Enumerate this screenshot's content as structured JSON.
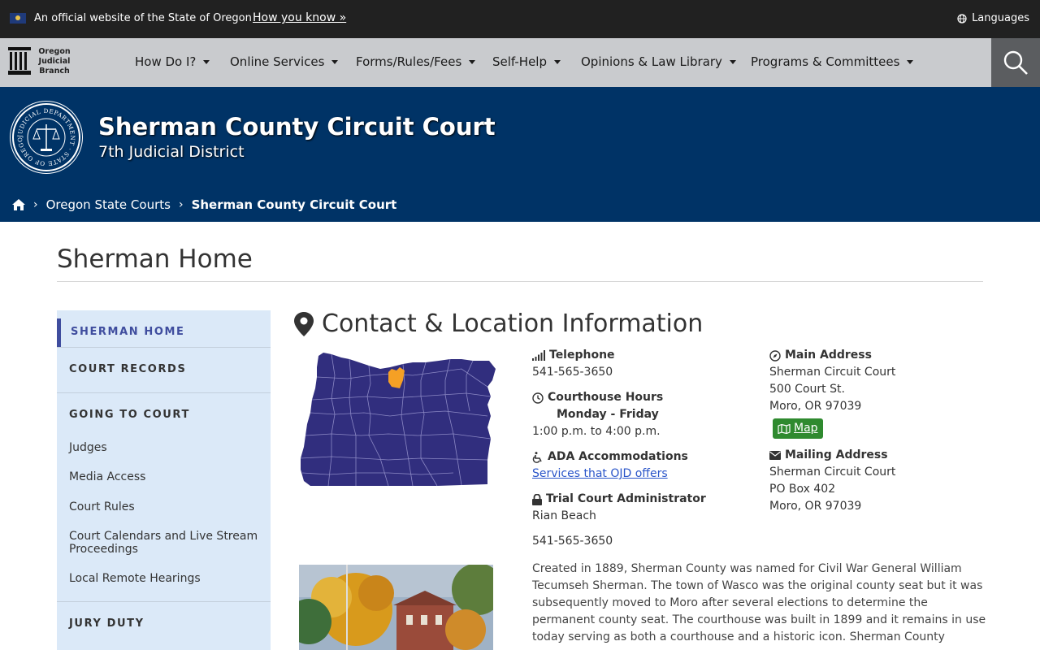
{
  "topbar": {
    "official_text": "An official website of the State of Oregon",
    "how_you_know": "How you know »",
    "languages": "Languages"
  },
  "logo": {
    "line1": "Oregon",
    "line2": "Judicial",
    "line3": "Branch"
  },
  "nav": {
    "items": [
      {
        "label": "How Do I?"
      },
      {
        "label": "Online Services"
      },
      {
        "label": "Forms/Rules/Fees"
      },
      {
        "label": "Self-Help"
      },
      {
        "label": "Opinions & Law Library"
      },
      {
        "label": "Programs & Committees"
      }
    ]
  },
  "banner": {
    "seal_text": "JUDICIAL DEPARTMENT · STATE OF OREGON",
    "title": "Sherman County Circuit Court",
    "subtitle": "7th Judicial District"
  },
  "breadcrumb": {
    "items": [
      "Oregon State Courts",
      "Sherman County Circuit Court"
    ]
  },
  "page": {
    "title": "Sherman Home"
  },
  "sidebar": {
    "sherman_home": "SHERMAN HOME",
    "court_records": "COURT RECORDS",
    "going_to_court": "GOING TO COURT",
    "links": [
      "Judges",
      "Media Access",
      "Court Rules",
      "Court Calendars and Live Stream Proceedings",
      "Local Remote Hearings"
    ],
    "jury_duty": "JURY DUTY"
  },
  "contact": {
    "heading": "Contact & Location Information",
    "telephone_label": "Telephone",
    "telephone": "541-565-3650",
    "hours_label": "Courthouse Hours",
    "hours_days": "Monday - Friday",
    "hours_time": "1:00 p.m. to 4:00 p.m.",
    "ada_label": "ADA Accommodations",
    "ada_link": "Services that OJD offers",
    "tca_label": "Trial Court Administrator",
    "tca_name": "Rian Beach",
    "tca_phone": "541-565-3650",
    "main_label": "Main Address",
    "main_line1": "Sherman Circuit Court",
    "main_line2": "500 Court St.",
    "main_line3": "Moro, OR 97039",
    "map_button": "Map",
    "mailing_label": "Mailing Address",
    "mail_line1": "Sherman Circuit Court",
    "mail_line2": "PO Box 402",
    "mail_line3": "Moro, OR 97039"
  },
  "description": "Created in 1889, Sherman County was named for Civil War General William Tecumseh Sherman. The town of Wasco was the original county seat but it was subsequently moved to Moro after several elections to determine the permanent county seat. The courthouse was built in 1899 and it remains in use today serving as both a courthouse and a historic icon. Sherman County",
  "colors": {
    "navy": "#003366",
    "nav_gray": "#c9cbce",
    "sidebar_bg": "#dbe9f8",
    "active": "#3f4d9e",
    "map_fill": "#312e7e",
    "map_highlight": "#f5a025",
    "map_button": "#2f8a2f"
  }
}
